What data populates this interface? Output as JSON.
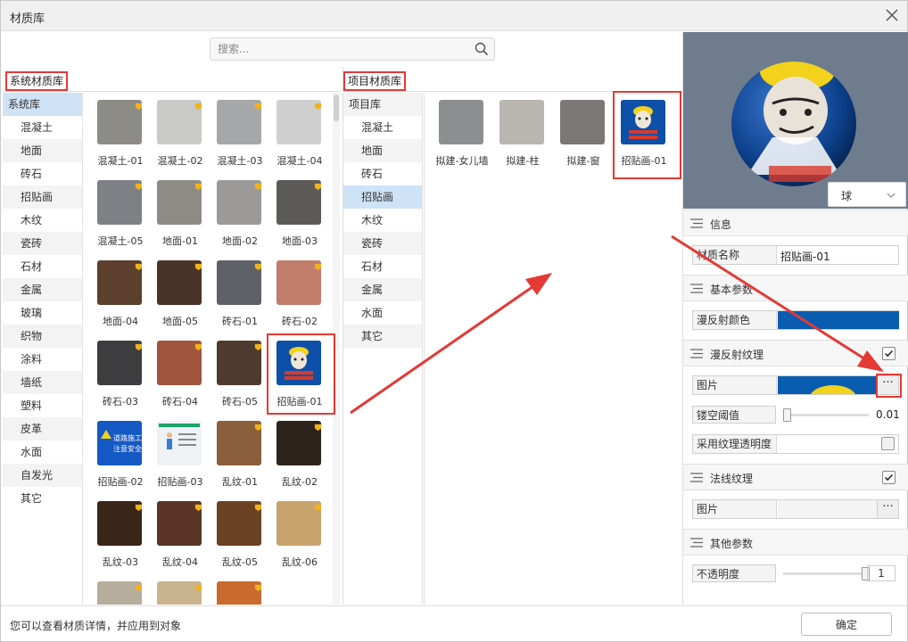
{
  "window": {
    "title": "材质库"
  },
  "search": {
    "placeholder": "搜索..."
  },
  "system_lib": {
    "header": "系统材质库",
    "categories": [
      "系统库",
      "混凝土",
      "地面",
      "砖石",
      "招贴画",
      "木纹",
      "瓷砖",
      "石材",
      "金属",
      "玻璃",
      "织物",
      "涂料",
      "墙纸",
      "塑料",
      "皮革",
      "水面",
      "自发光",
      "其它"
    ],
    "tiles": [
      {
        "label": "混凝土-01",
        "color": "#8d8b86"
      },
      {
        "label": "混凝土-02",
        "color": "#c9c9c6"
      },
      {
        "label": "混凝土-03",
        "color": "#a5a7a8"
      },
      {
        "label": "混凝土-04",
        "color": "#cfcfcf"
      },
      {
        "label": "混凝土-05",
        "color": "#7d8185"
      },
      {
        "label": "地面-01",
        "color": "#8f8c88"
      },
      {
        "label": "地面-02",
        "color": "#9b9a99"
      },
      {
        "label": "地面-03",
        "color": "#5c5a57"
      },
      {
        "label": "地面-04",
        "color": "#5c3f2c"
      },
      {
        "label": "地面-05",
        "color": "#4a3328"
      },
      {
        "label": "砖石-01",
        "color": "#5e6166"
      },
      {
        "label": "砖石-02",
        "color": "#c07d6c"
      },
      {
        "label": "砖石-03",
        "color": "#3d3d3f"
      },
      {
        "label": "砖石-04",
        "color": "#a0553d"
      },
      {
        "label": "砖石-05",
        "color": "#4f3a30"
      },
      {
        "label": "招贴画-01",
        "color": "#0e4fa8"
      },
      {
        "label": "招贴画-02",
        "color": "#1559c4"
      },
      {
        "label": "招贴画-03",
        "color": "#e9eef2"
      },
      {
        "label": "乱纹-01",
        "color": "#8b5e3c"
      },
      {
        "label": "乱纹-02",
        "color": "#2e221c"
      },
      {
        "label": "乱纹-03",
        "color": "#3a2519"
      },
      {
        "label": "乱纹-04",
        "color": "#5a3525"
      },
      {
        "label": "乱纹-05",
        "color": "#6b4123"
      },
      {
        "label": "乱纹-06",
        "color": "#c9a36e"
      },
      {
        "label": "",
        "color": "#b6ad9c"
      },
      {
        "label": "",
        "color": "#c9b48f"
      },
      {
        "label": "",
        "color": "#c96a2e"
      }
    ],
    "poster_02_line1": "道路施工",
    "poster_02_line2": "注意安全"
  },
  "project_lib": {
    "header": "项目材质库",
    "categories": [
      "项目库",
      "混凝土",
      "地面",
      "砖石",
      "招贴画",
      "木纹",
      "瓷砖",
      "石材",
      "金属",
      "水面",
      "其它"
    ],
    "tiles": [
      {
        "label": "拟建-女儿墙",
        "color": "#8c8f90"
      },
      {
        "label": "拟建-柱",
        "color": "#b9b5b0"
      },
      {
        "label": "拟建-窗",
        "color": "#7b7876"
      },
      {
        "label": "招贴画-01",
        "color": "#0e4fa8"
      }
    ]
  },
  "preview": {
    "shape": "球"
  },
  "info": {
    "title": "信息",
    "name_label": "材质名称",
    "name_value": "招贴画-01"
  },
  "basic": {
    "title": "基本参数",
    "diffuse_color_label": "漫反射颜色",
    "diffuse_color": "#0a5cb0"
  },
  "diffuse_texture": {
    "title": "漫反射纹理",
    "enabled": true,
    "image_label": "图片",
    "more_label": "···",
    "cutout_label": "镂空阈值",
    "cutout_value": "0.01",
    "alpha_label": "采用纹理透明度"
  },
  "normal_texture": {
    "title": "法线纹理",
    "enabled": true,
    "image_label": "图片",
    "more_label": "···"
  },
  "other": {
    "title": "其他参数",
    "opacity_label": "不透明度",
    "opacity_value": "1"
  },
  "status": {
    "message": "您可以查看材质详情，并应用到对象",
    "ok_label": "确定"
  },
  "colors": {
    "selected_bg": "#cfe3f7",
    "annotation_red": "#e53935",
    "accent_blue": "#0a5cb0"
  }
}
